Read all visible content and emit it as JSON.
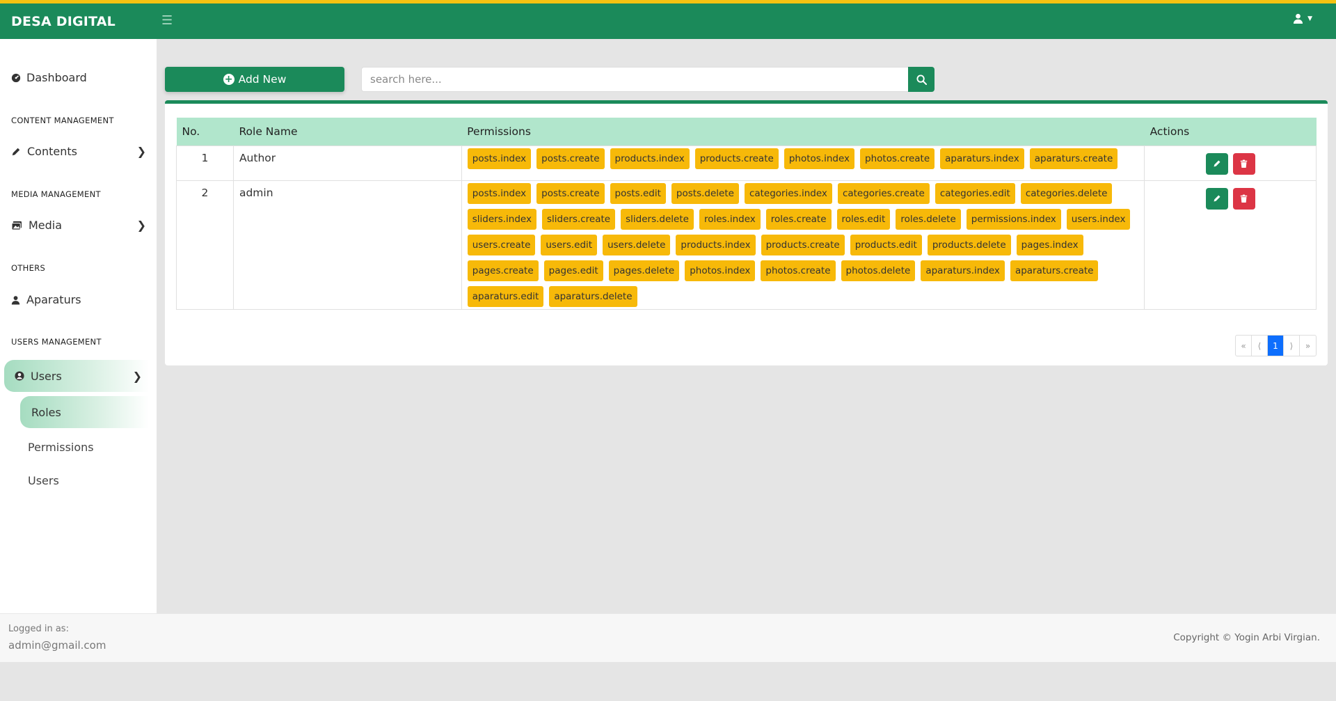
{
  "header": {
    "brand": "DESA DIGITAL",
    "menu_icon": "hamburger-icon",
    "user_icon": "user-icon"
  },
  "sidebar": {
    "dashboard": "Dashboard",
    "sections": {
      "content": "CONTENT MANAGEMENT",
      "media": "MEDIA MANAGEMENT",
      "others": "OTHERS",
      "users": "USERS MANAGEMENT"
    },
    "contents": "Contents",
    "media": "Media",
    "aparaturs": "Aparaturs",
    "users": "Users",
    "sub": {
      "roles": "Roles",
      "permissions": "Permissions",
      "users": "Users"
    }
  },
  "toolbar": {
    "add_label": "Add New",
    "search_placeholder": "search here..."
  },
  "table": {
    "headers": {
      "no": "No.",
      "role": "Role Name",
      "permissions": "Permissions",
      "actions": "Actions"
    },
    "rows": [
      {
        "no": "1",
        "role": "Author",
        "permissions": [
          "posts.index",
          "posts.create",
          "products.index",
          "products.create",
          "photos.index",
          "photos.create",
          "aparaturs.index",
          "aparaturs.create"
        ]
      },
      {
        "no": "2",
        "role": "admin",
        "permissions": [
          "posts.index",
          "posts.create",
          "posts.edit",
          "posts.delete",
          "categories.index",
          "categories.create",
          "categories.edit",
          "categories.delete",
          "sliders.index",
          "sliders.create",
          "sliders.delete",
          "roles.index",
          "roles.create",
          "roles.edit",
          "roles.delete",
          "permissions.index",
          "users.index",
          "users.create",
          "users.edit",
          "users.delete",
          "products.index",
          "products.create",
          "products.edit",
          "products.delete",
          "pages.index",
          "pages.create",
          "pages.edit",
          "pages.delete",
          "photos.index",
          "photos.create",
          "photos.delete",
          "aparaturs.index",
          "aparaturs.create",
          "aparaturs.edit",
          "aparaturs.delete"
        ]
      }
    ]
  },
  "pagination": {
    "first": "«",
    "prev": "⟨",
    "current": "1",
    "next": "⟩",
    "last": "»"
  },
  "footer": {
    "logged_label": "Logged in as:",
    "email": "admin@gmail.com",
    "copyright": "Copyright © Yogin Arbi Virgian."
  },
  "colors": {
    "primary": "#1b8a5a",
    "accent": "#f5c211",
    "badge": "#f7b909",
    "danger": "#dc3545",
    "header_row": "#b1e6cc"
  }
}
